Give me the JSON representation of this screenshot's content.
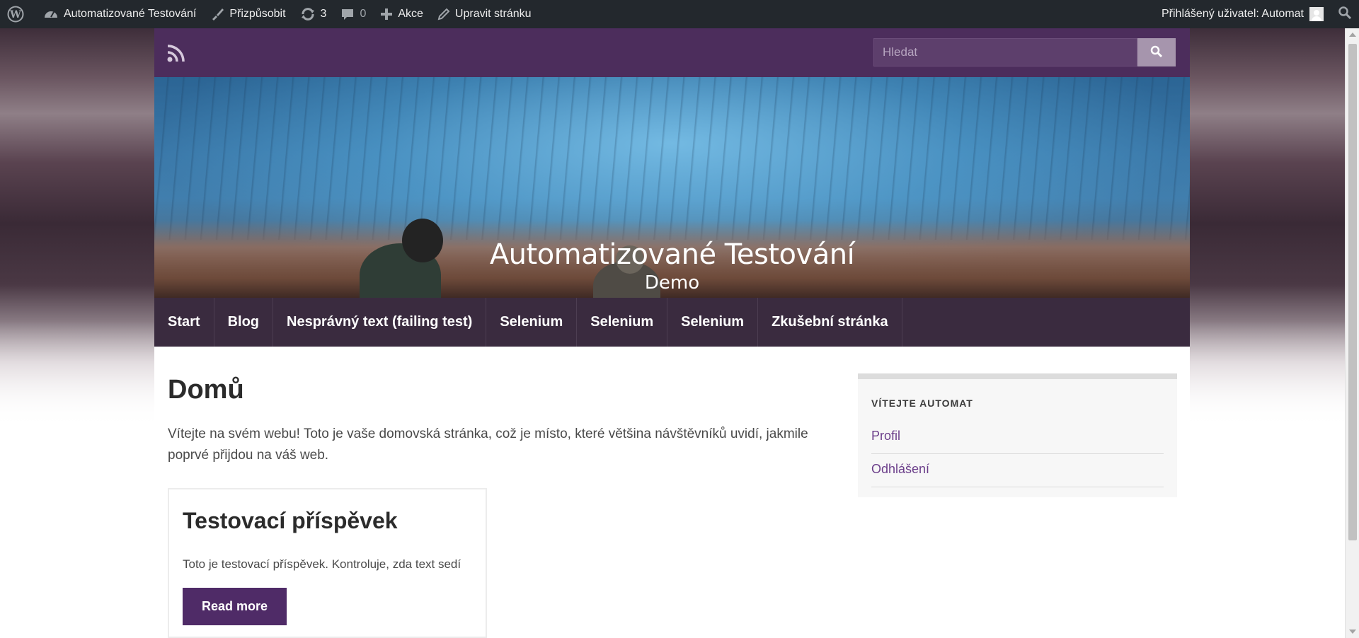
{
  "adminbar": {
    "wp_logo": "wordpress-icon",
    "site_name": "Automatizované Testování",
    "customize": "Přizpůsobit",
    "updates_count": "3",
    "comments_count": "0",
    "new_label": "Akce",
    "edit_page": "Upravit stránku",
    "user_greeting": "Přihlášený uživatel: Automat"
  },
  "header": {
    "search_placeholder": "Hledat",
    "site_title": "Automatizované Testování",
    "site_description": "Demo"
  },
  "nav": {
    "items": [
      {
        "label": "Start"
      },
      {
        "label": "Blog"
      },
      {
        "label": "Nesprávný text (failing test)"
      },
      {
        "label": "Selenium"
      },
      {
        "label": "Selenium"
      },
      {
        "label": "Selenium"
      },
      {
        "label": "Zkušební stránka"
      }
    ]
  },
  "main": {
    "page_title": "Domů",
    "intro": "Vítejte na svém webu! Toto je vaše domovská stránka, což je místo, které většina návštěvníků uvidí, jakmile poprvé přijdou na váš web.",
    "post": {
      "title": "Testovací příspěvek",
      "excerpt": "Toto je testovací příspěvek. Kontroluje, zda text sedí",
      "read_more": "Read more"
    }
  },
  "sidebar": {
    "widget_title": "VÍTEJTE AUTOMAT",
    "links": [
      {
        "label": "Profil"
      },
      {
        "label": "Odhlášení"
      }
    ]
  },
  "colors": {
    "adminbar": "#23282d",
    "topbar": "#4c2d5c",
    "nav": "#3a2b3f",
    "button": "#4f2b67",
    "link": "#6b3e8a"
  }
}
